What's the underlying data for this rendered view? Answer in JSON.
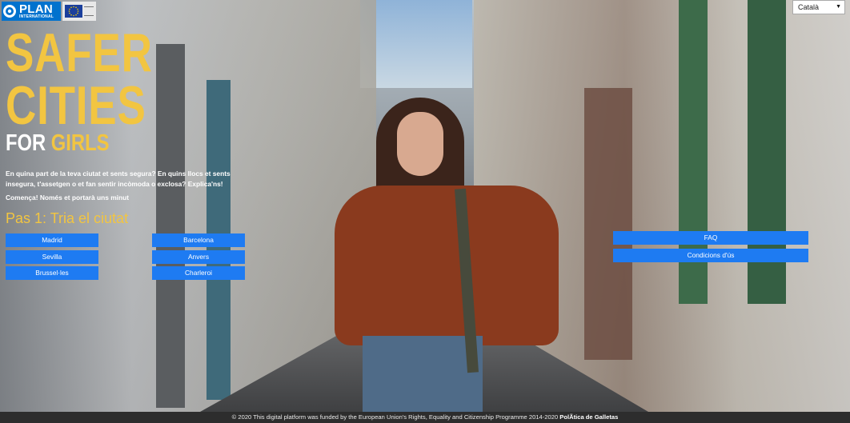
{
  "header": {
    "plan_logo": {
      "name": "PLAN",
      "sub": "INTERNATIONAL"
    },
    "language": "Català"
  },
  "hero": {
    "title_line1": "SAFER",
    "title_line2": "CITIES",
    "title_for": "FOR",
    "title_girls": "GIRLS",
    "intro": "En quina part de la teva ciutat et sents segura? En quins llocs et sents insegura, t'assetgen o et fan sentir incòmoda o exclosa? Explica'ns!",
    "start": "Comença! Només et portarà uns minut",
    "step": "Pas 1: Tria el ciutat"
  },
  "cities": [
    {
      "label": "Madrid"
    },
    {
      "label": "Sevilla"
    },
    {
      "label": "Brussel·les"
    },
    {
      "label": "Barcelona"
    },
    {
      "label": "Anvers"
    },
    {
      "label": "Charleroi"
    }
  ],
  "links": {
    "faq": "FAQ",
    "terms": "Condicions d'ús"
  },
  "footer": {
    "copyright": "©  2020   This digital platform was funded by the European Union's Rights, Equality and Citizenship Programme 2014-2020",
    "credit": "PolÃtica de Galletas"
  },
  "colors": {
    "accent_yellow": "#f2c541",
    "button_blue": "#1e7bf2",
    "plan_blue": "#0072ce"
  },
  "icons": [
    "plan-logo-icon",
    "eu-flag-icon",
    "chevron-down-icon"
  ]
}
